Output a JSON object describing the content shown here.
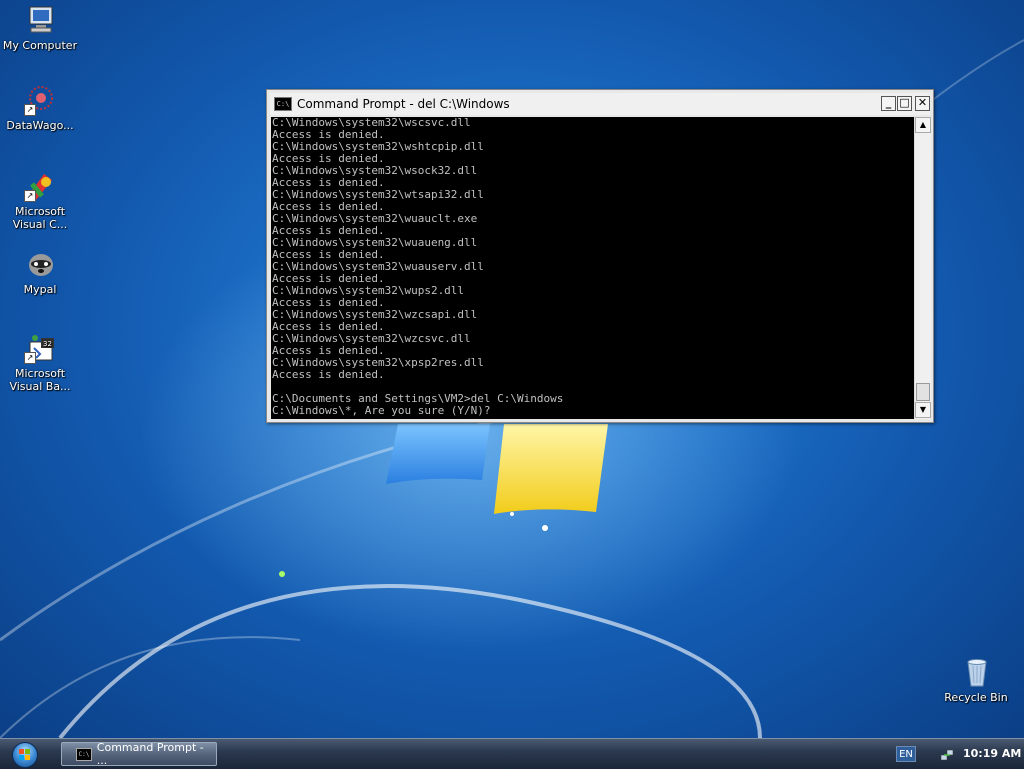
{
  "desktop": {
    "icons": [
      {
        "label": "My Computer",
        "icon": "my-computer-icon"
      },
      {
        "label": "DataWago...",
        "icon": "datawagon-icon"
      },
      {
        "label": "Microsoft Visual C...",
        "icon": "visual-c-icon"
      },
      {
        "label": "Mypal",
        "icon": "mypal-icon"
      },
      {
        "label": "Microsoft Visual Ba...",
        "icon": "visual-basic-icon"
      },
      {
        "label": "Recycle Bin",
        "icon": "recycle-bin-icon"
      }
    ]
  },
  "window": {
    "title": "Command Prompt - del C:\\Windows",
    "icon_text": "C:\\",
    "minimize_glyph": "_",
    "maximize_glyph": "□",
    "close_glyph": "✕",
    "console_lines": [
      "C:\\Windows\\system32\\wscsvc.dll",
      "Access is denied.",
      "C:\\Windows\\system32\\wshtcpip.dll",
      "Access is denied.",
      "C:\\Windows\\system32\\wsock32.dll",
      "Access is denied.",
      "C:\\Windows\\system32\\wtsapi32.dll",
      "Access is denied.",
      "C:\\Windows\\system32\\wuauclt.exe",
      "Access is denied.",
      "C:\\Windows\\system32\\wuaueng.dll",
      "Access is denied.",
      "C:\\Windows\\system32\\wuauserv.dll",
      "Access is denied.",
      "C:\\Windows\\system32\\wups2.dll",
      "Access is denied.",
      "C:\\Windows\\system32\\wzcsapi.dll",
      "Access is denied.",
      "C:\\Windows\\system32\\wzcsvc.dll",
      "Access is denied.",
      "C:\\Windows\\system32\\xpsp2res.dll",
      "Access is denied.",
      "",
      "C:\\Documents and Settings\\VM2>del C:\\Windows",
      "C:\\Windows\\*, Are you sure (Y/N)?"
    ],
    "scrollbar": {
      "up_glyph": "▲",
      "down_glyph": "▼"
    }
  },
  "taskbar": {
    "start_icon": "windows-start-icon",
    "task_button_label": "Command Prompt - ...",
    "task_icon_text": "C:\\",
    "language": "EN",
    "clock": "10:19 AM"
  },
  "colors": {
    "console_bg": "#000000",
    "console_fg": "#c0c0c0",
    "desktop_accent": "#1c6fc8"
  }
}
